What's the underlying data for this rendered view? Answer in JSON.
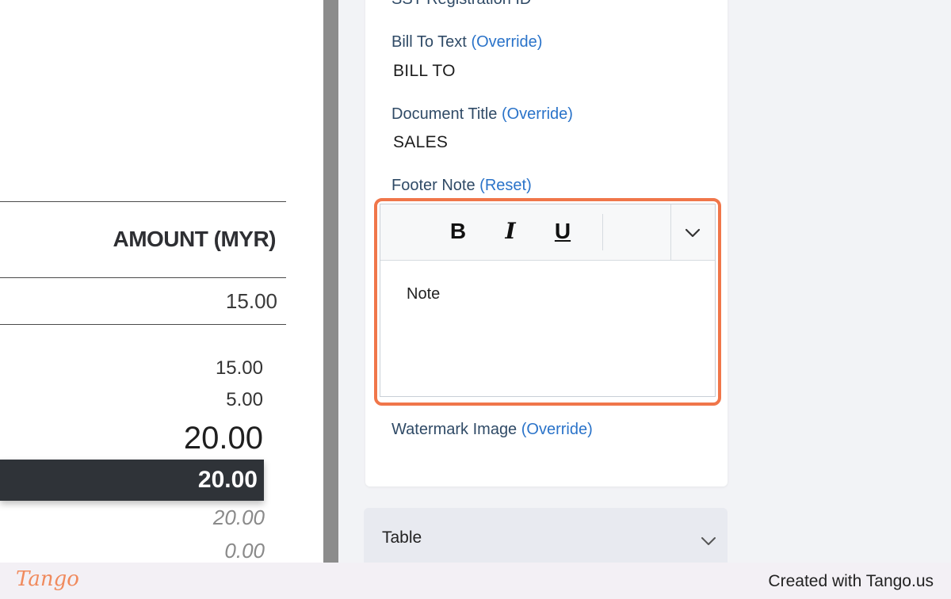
{
  "document": {
    "amount_header": "AMOUNT (MYR)",
    "line_amount": "15.00",
    "subtotal": "15.00",
    "tax": "5.00",
    "total": "20.00",
    "total_highlight": "20.00",
    "paid": "20.00",
    "balance": "0.00"
  },
  "settings": {
    "cut_label": "SST Registration ID",
    "bill_to": {
      "label": "Bill To Text",
      "action": "(Override)",
      "value": "BILL TO"
    },
    "doc_title": {
      "label": "Document Title",
      "action": "(Override)",
      "value": "SALES"
    },
    "footer_note": {
      "label": "Footer Note",
      "action": "(Reset)",
      "toolbar": {
        "bold": "B",
        "italic": "I",
        "underline": "U"
      },
      "content": "Note"
    },
    "watermark": {
      "label": "Watermark Image",
      "action": "(Override)"
    }
  },
  "table_section": {
    "label": "Table",
    "icon": "chevron-down-icon"
  },
  "footer": {
    "brand": "Tango",
    "credit": "Created with Tango.us"
  },
  "colors": {
    "highlight": "#f0764a",
    "link": "#2a73c9",
    "total_bar": "#2f3338"
  }
}
